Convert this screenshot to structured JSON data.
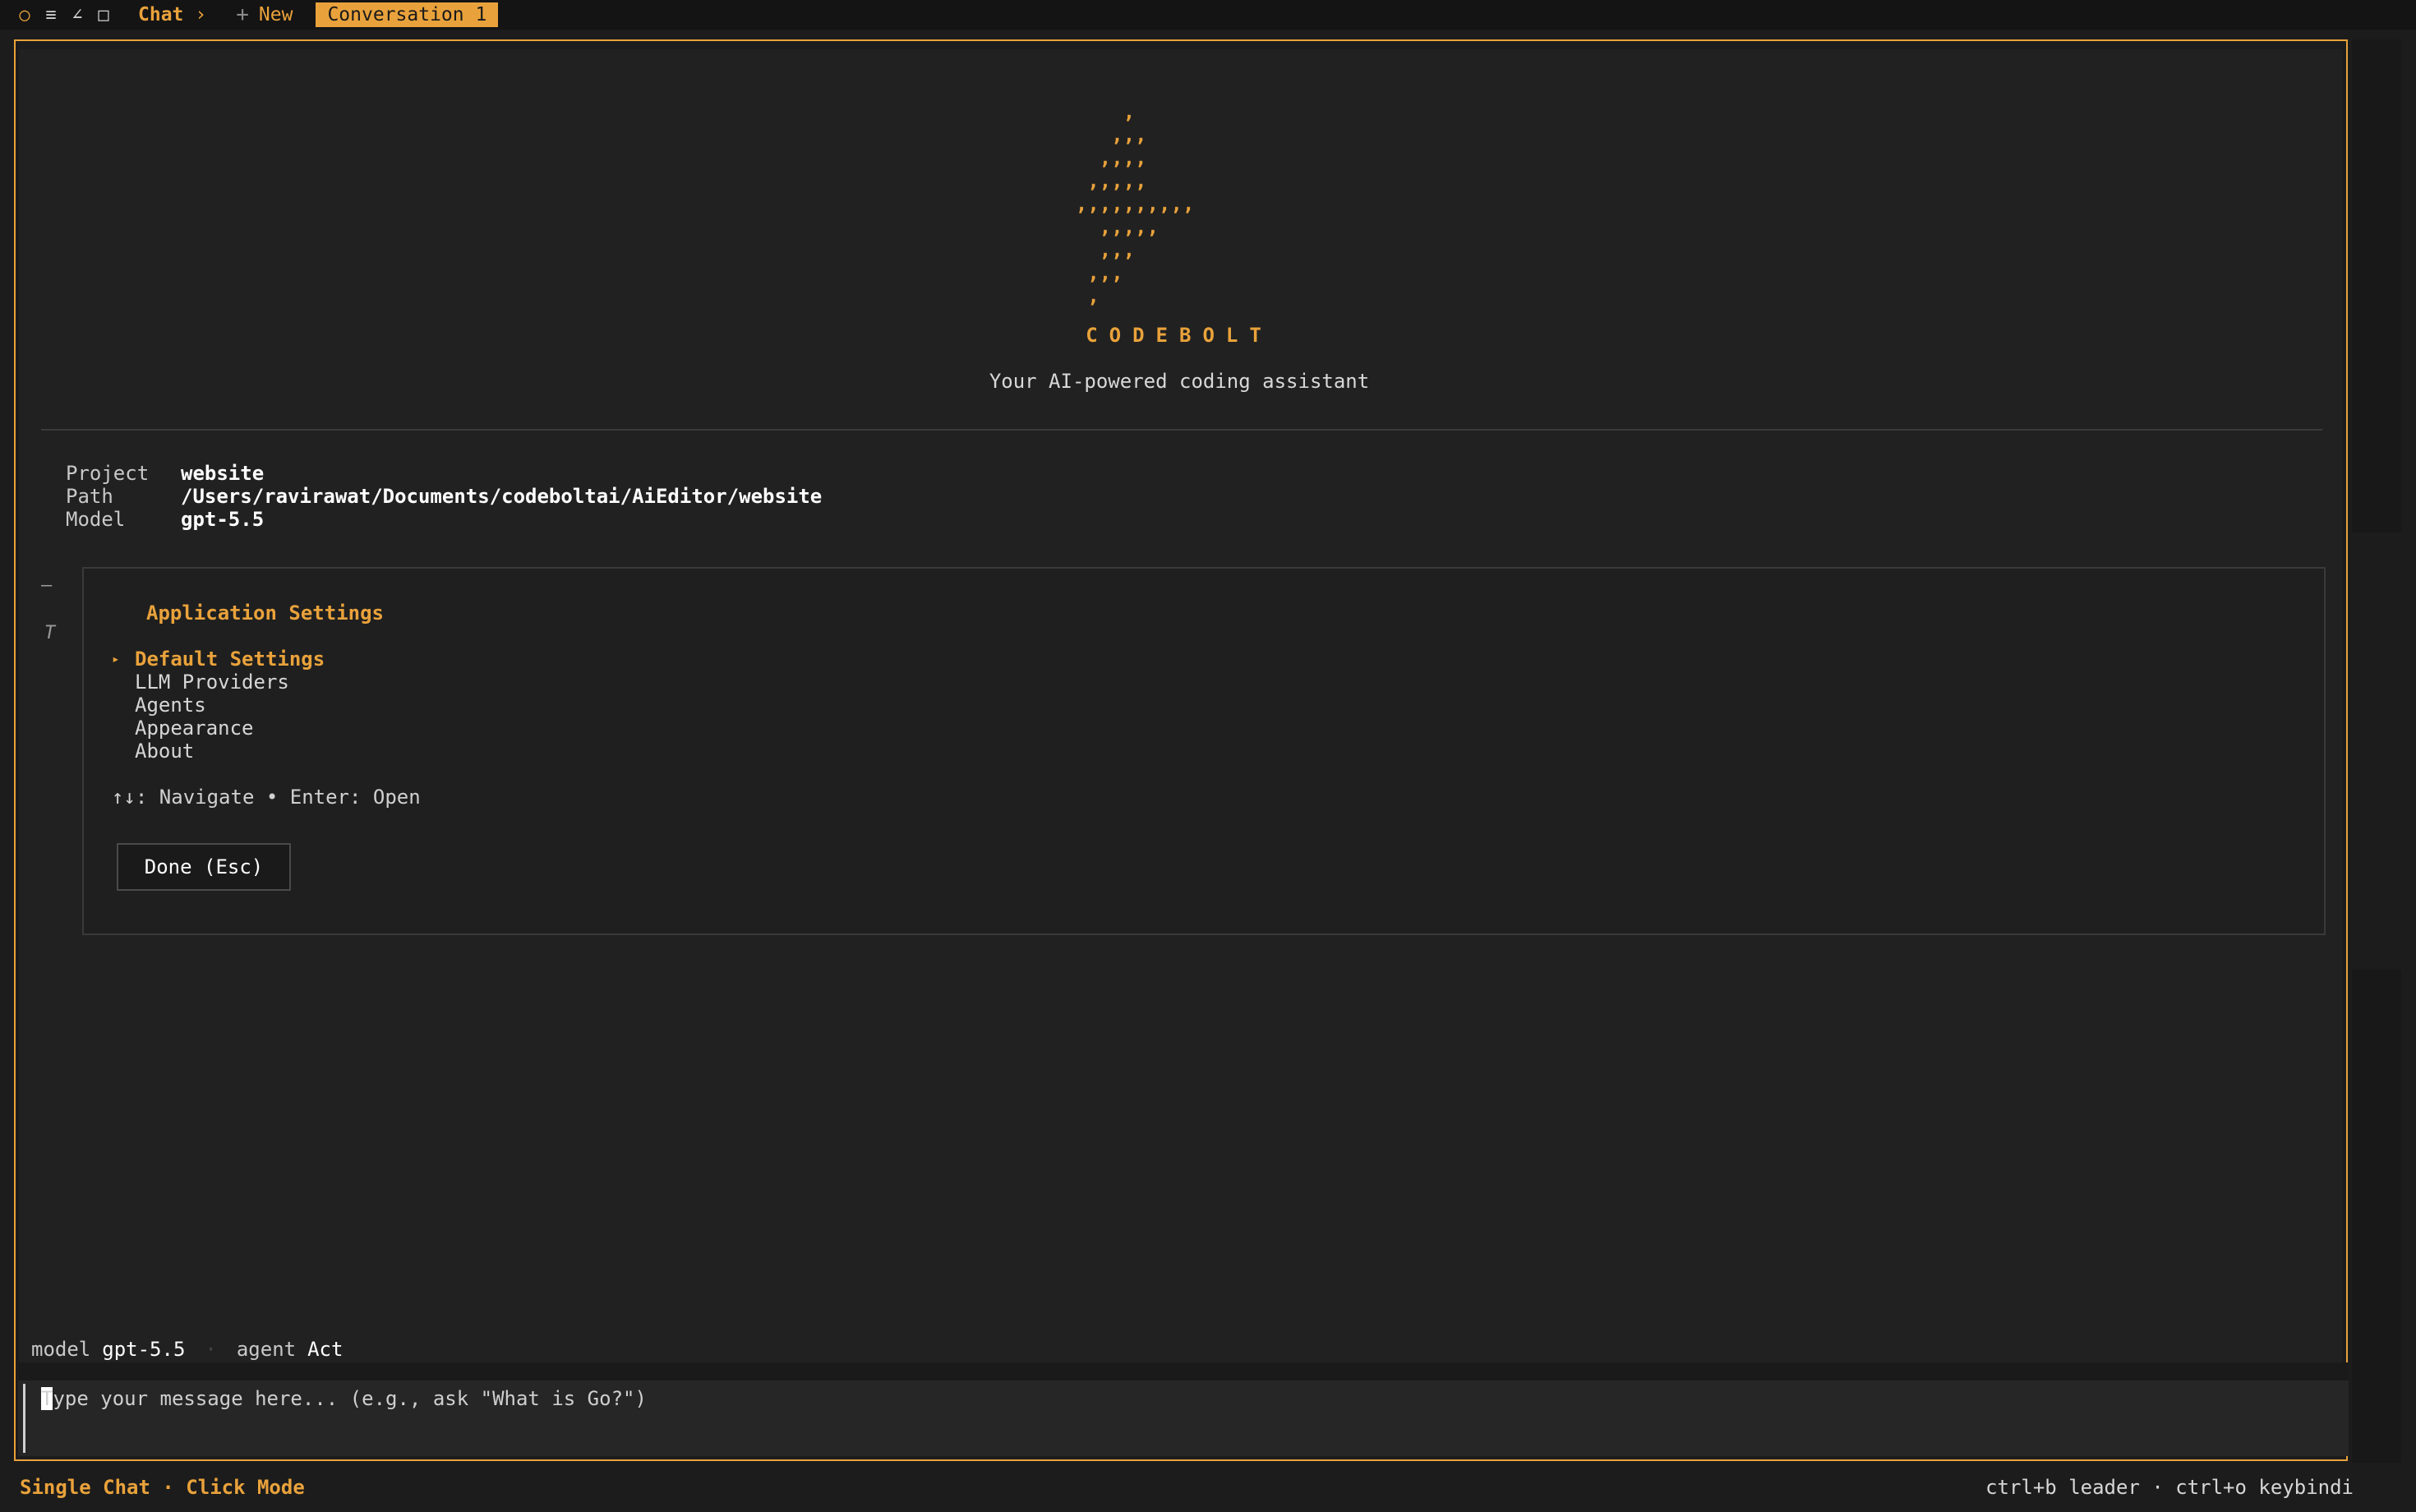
{
  "topbar": {
    "chat_label": "Chat",
    "chevron": "›",
    "new_label": "New",
    "active_tab": "Conversation 1",
    "icons": [
      "circle-icon",
      "menu-icon",
      "pen-icon",
      "square-icon",
      "plus-icon"
    ]
  },
  "logo": {
    "ascii": "      ,\n     ,,,\n    ,,,,\n   ,,,,,\n  ,,,,,,,,,,\n    ,,,,,\n    ,,,\n   ,,,\n   ,",
    "brand": "CODEBOLT",
    "tagline": "Your AI-powered coding assistant"
  },
  "project": {
    "project_key": "Project",
    "project_val": "website",
    "path_key": "Path",
    "path_val": "/Users/ravirawat/Documents/codeboltai/AiEditor/website",
    "model_key": "Model",
    "model_val": "gpt-5.5"
  },
  "side": {
    "dash": "—",
    "t": "T"
  },
  "settings": {
    "title": "Application Settings",
    "marker": "▸",
    "items": [
      "Default Settings",
      "LLM Providers",
      "Agents",
      "Appearance",
      "About"
    ],
    "hint": "↑↓: Navigate • Enter: Open",
    "done_label": "Done (Esc)"
  },
  "status": {
    "model_key": "model",
    "model_val": "gpt-5.5",
    "agent_key": "agent",
    "agent_val": "Act"
  },
  "input": {
    "placeholder": "Type your message here... (e.g., ask \"What is Go?\")"
  },
  "footer": {
    "left": "Single Chat · Click Mode",
    "right": "ctrl+b leader · ctrl+o keybindi"
  },
  "colors": {
    "accent": "#e9a23b",
    "background": "#212121"
  }
}
